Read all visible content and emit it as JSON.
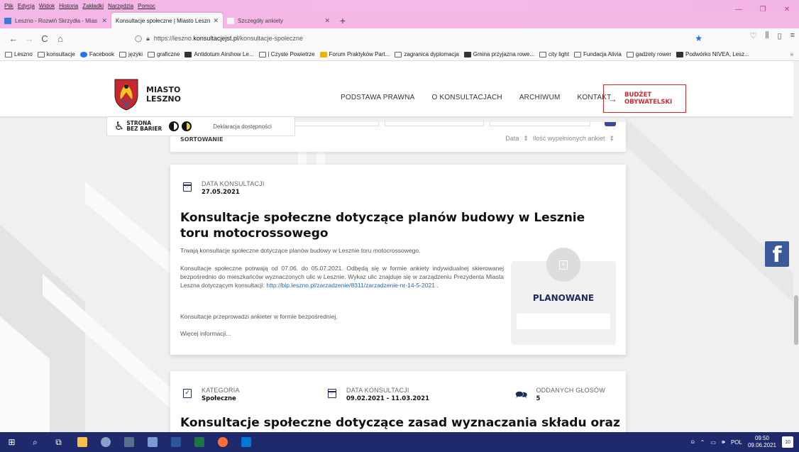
{
  "menubar": [
    "Plik",
    "Edycja",
    "Widok",
    "Historia",
    "Zakładki",
    "Narzędzia",
    "Pomoc"
  ],
  "tabs": [
    {
      "title": "Leszno - Rozwiń Skrzydła - Mias",
      "color": "#3a7bd5",
      "active": false
    },
    {
      "title": "Konsultacje społeczne | Miasto Leszn",
      "color": "#d0292f",
      "active": true
    },
    {
      "title": "Szczegóły ankiety",
      "color": "#f5f5f5",
      "active": false
    }
  ],
  "toolbar": {
    "back": "←",
    "forward": "→",
    "reload": "C",
    "home": "⌂",
    "url_prefix": "https://leszno.",
    "url_domain": "konsultacjejst.pl",
    "url_path": "/konsultacje-spoleczne",
    "star": "★"
  },
  "bookmarks": [
    {
      "label": "Leszno",
      "icon": "folder"
    },
    {
      "label": "konsultacje",
      "icon": "folder"
    },
    {
      "label": "Facebook",
      "icon": "blue"
    },
    {
      "label": "języki",
      "icon": "folder"
    },
    {
      "label": "graficzne",
      "icon": "folder"
    },
    {
      "label": "Antidotum Airshow Le...",
      "icon": "dark"
    },
    {
      "label": "| Czyste Powietrze",
      "icon": "folder"
    },
    {
      "label": "Forum Praktyków Part...",
      "icon": "yellow"
    },
    {
      "label": "zagranica dyplomacja",
      "icon": "folder"
    },
    {
      "label": "Gmina przyjazna rowe...",
      "icon": "dark"
    },
    {
      "label": "city light",
      "icon": "folder"
    },
    {
      "label": "Fundacja Alivia",
      "icon": "folder"
    },
    {
      "label": "gadżety rower",
      "icon": "folder"
    },
    {
      "label": "Podwórko NIVEA, Lesz...",
      "icon": "dark"
    }
  ],
  "site": {
    "logo_line1": "MIASTO",
    "logo_line2": "LESZNO",
    "nav": [
      "PODSTAWA PRAWNA",
      "O KONSULTACJACH",
      "ARCHIWUM",
      "KONTAKT"
    ],
    "budzet_line1": "BUDŻET",
    "budzet_line2": "OBYWATELSKI",
    "access_line1": "STRONA",
    "access_line2": "BEZ BARIER",
    "declaration": "Deklaracja dostępności"
  },
  "sort": {
    "label": "SORTOWANIE",
    "option1": "Data",
    "option2": "Ilość wypełnionych ankiet",
    "arrows": "⇕"
  },
  "card1": {
    "date_label": "DATA KONSULTACJI",
    "date_value": "27.05.2021",
    "title": "Konsultacje społeczne dotyczące planów budowy w Lesznie toru motocrossowego",
    "lead": "Trwają konsultacje społeczne dotyczące planów budowy w Lesznie toru motocrossowego.",
    "body": "Konsultacje społeczne potrwają od 07.06. do 05.07.2021. Odbędą się w formie ankiety indywidualnej skierowanej bezpośrednio do mieszkańców wyznaczonych ulic w Lesznie. Wykaz ulic znajduje się w zarządzeniu Prezydenta Miasta Leszna dotyczącym konsultacji: ",
    "link": "http://bip.leszno.pl/zarzadzenie/8311/zarzadzenie-nr-14-5-2021",
    "body_end": " .",
    "p2": "Konsultacje przeprowadzi ankieter w formie bezpośredniej.",
    "more": "Więcej informacji...",
    "status": "PLANOWANE"
  },
  "card2": {
    "cat_label": "KATEGORIA",
    "cat_value": "Społeczne",
    "date_label": "DATA KONSULTACJI",
    "date_value": "09.02.2021 - 11.03.2021",
    "votes_label": "ODDANYCH GŁOSÓW",
    "votes_value": "5",
    "title": "Konsultacje społeczne dotyczące zasad wyznaczania składu oraz"
  },
  "facebook": "f",
  "taskbar": {
    "lang": "POL",
    "time": "09:50",
    "date": "09.06.2021",
    "notif": "10"
  },
  "colors": {
    "navy": "#1e2a5a",
    "red": "#d0292f",
    "link": "#2a64b5",
    "chrome_pink": "#f4b6e6",
    "taskbar": "#1e2a6b"
  }
}
